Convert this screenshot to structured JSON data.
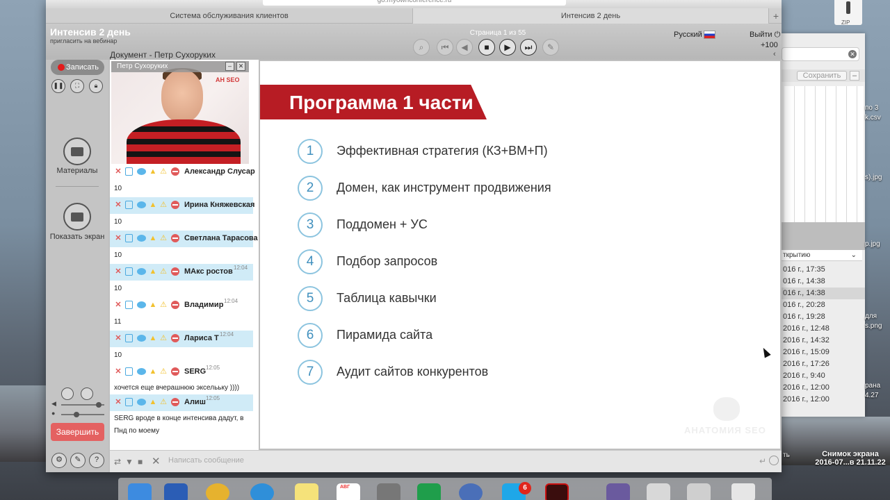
{
  "desktop": {
    "zip_label": "ZIP",
    "screenshot_title": "Снимок экрана",
    "screenshot_date": "2016-07...в 21.11.22",
    "side_labels": [
      "по 3",
      "k.csv",
      "s).jpg",
      "p.jpg",
      "для",
      "s.png",
      "рана",
      "4.27",
      "ть"
    ]
  },
  "bg_window": {
    "save_label": "Сохранить",
    "dropdown_label": "ткрытию",
    "rows": [
      "016 г., 17:35",
      "016 г., 14:38",
      "016 г., 14:38",
      "016 г., 20:28",
      "016 г., 19:28",
      "2016 г., 12:48",
      "2016 г., 14:32",
      "2016 г., 15:09",
      "2016 г., 17:26",
      "2016 г., 9:40",
      "2016 г., 12:00",
      "2016 г., 12:00"
    ]
  },
  "browser": {
    "url": "go.myownconference.ru",
    "tabs": [
      "Система обслуживания клиентов",
      "Интенсив 2 день"
    ]
  },
  "app": {
    "title": "Интенсив 2 день",
    "invite": "пригласить на вебинар",
    "document_label": "Документ - Петр Сухоруких",
    "page_indicator": "Страница 1 из 55",
    "language": "Русский",
    "exit_label": "Выйти",
    "plus_count": "+100",
    "record_label": "Записать",
    "materials_label": "Материалы",
    "show_screen_label": "Показать экран",
    "end_label": "Завершить"
  },
  "video": {
    "presenter_name": "Петр Сухоруких",
    "wall_text": "АН SEO"
  },
  "chat": {
    "messages": [
      {
        "name": "Александр Слусар",
        "time": "",
        "text": "10"
      },
      {
        "name": "Ирина Княжевская",
        "time": "",
        "text": "10"
      },
      {
        "name": "Светлана Тарасова",
        "time": "",
        "text": "10"
      },
      {
        "name": "МАкс ростов",
        "time": "12:04",
        "text": "10"
      },
      {
        "name": "Владимир",
        "time": "12:04",
        "text": "11"
      },
      {
        "name": "Лариса Т",
        "time": "12:04",
        "text": "10"
      },
      {
        "name": "SERG",
        "time": "12:05",
        "text": "хочется еще вчерашнюю экселььку ))))"
      },
      {
        "name": "Алиш",
        "time": "12:05",
        "text": "SERG вроде в конце интенсива дадут, в Пнд по моему"
      }
    ],
    "input_placeholder": "Написать сообщение"
  },
  "slide": {
    "title": "Программа 1 части",
    "items": [
      {
        "num": "1",
        "text": "Эффективная стратегия (КЗ+ВМ+П)"
      },
      {
        "num": "2",
        "text": "Домен, как инструмент продвижения"
      },
      {
        "num": "3",
        "text": "Поддомен + УС"
      },
      {
        "num": "4",
        "text": "Подбор запросов"
      },
      {
        "num": "5",
        "text": "Таблица кавычки"
      },
      {
        "num": "6",
        "text": "Пирамида сайта"
      },
      {
        "num": "7",
        "text": "Аудит сайтов конкурентов"
      }
    ],
    "watermark": "АНАТОМИЯ SEO"
  },
  "dock": {
    "skype_badge": "6",
    "calendar_month": "АВГ"
  },
  "colors": {
    "slide_accent": "#b71c24",
    "number_circle": "#8cc4df",
    "chat_highlight": "#d0ebf7",
    "end_button": "#e46161",
    "record_dot": "#e31b1b"
  }
}
